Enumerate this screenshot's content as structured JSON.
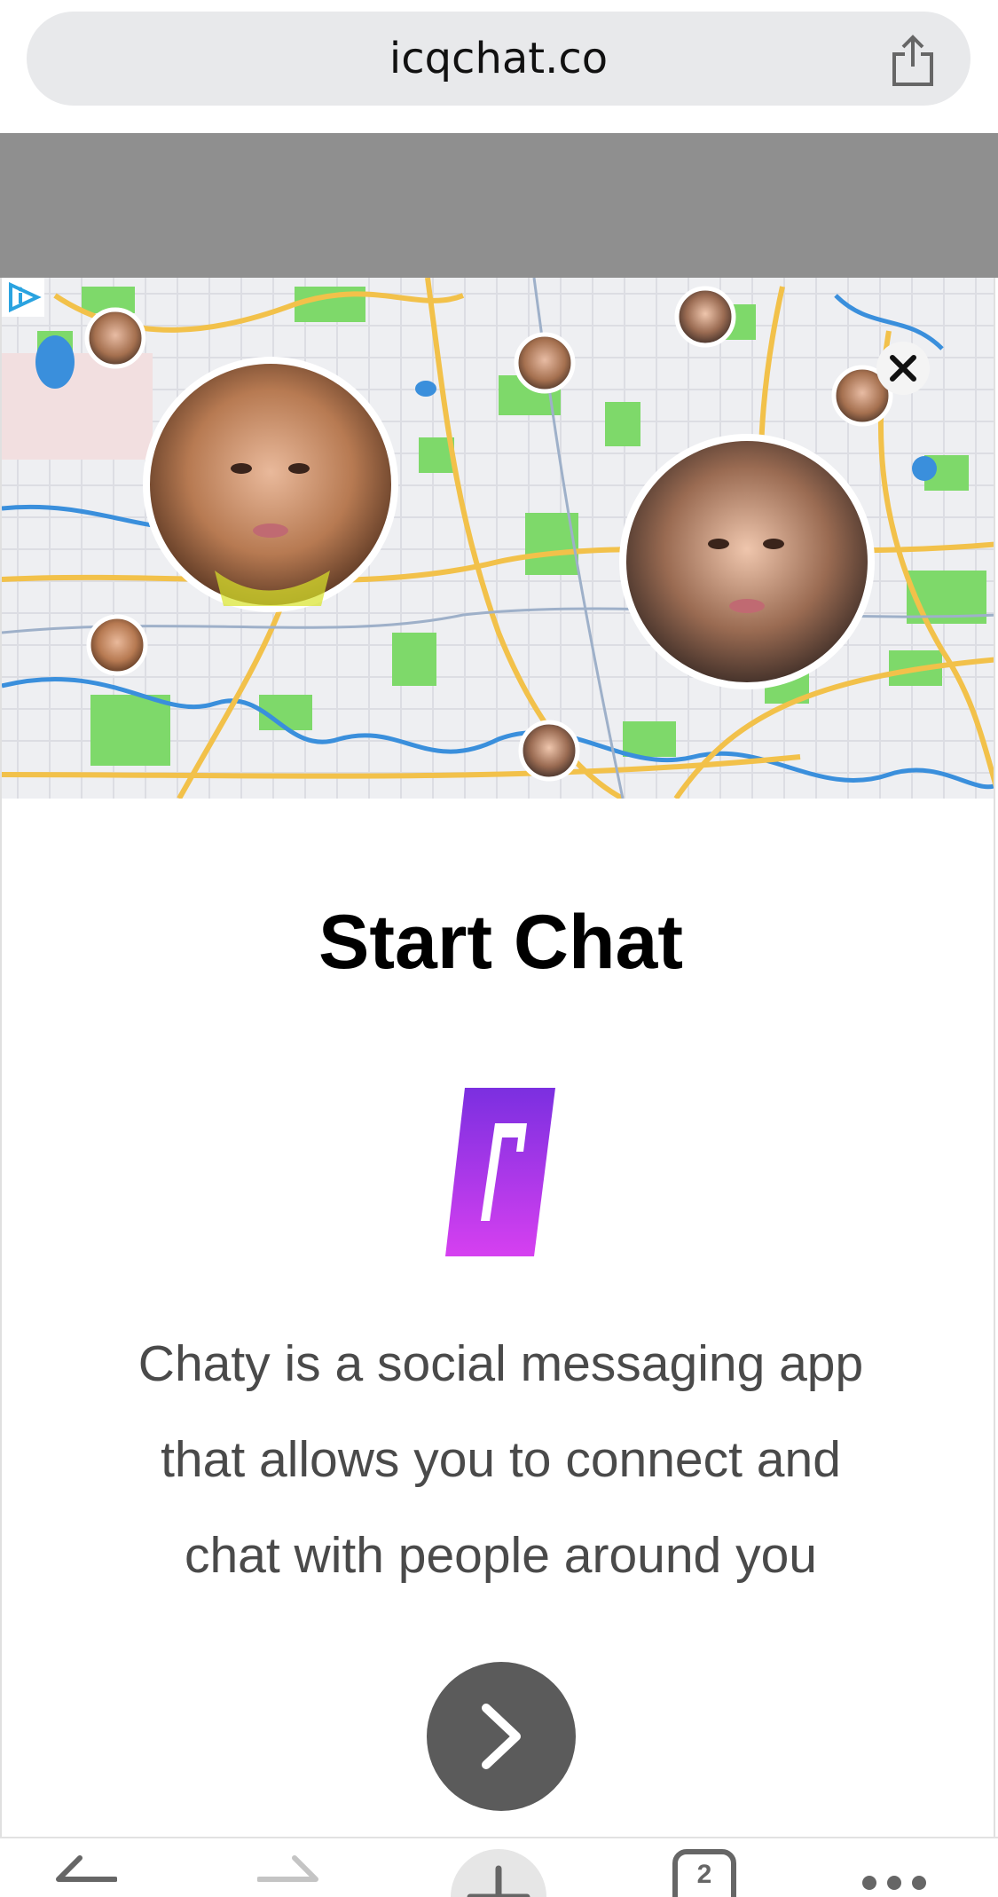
{
  "browser": {
    "url": "icqchat.co",
    "icons": [
      "share-icon",
      "back-arrow-icon",
      "forward-arrow-icon",
      "new-tab-plus-icon",
      "tabs-icon",
      "more-icon"
    ],
    "tab_count": "2"
  },
  "ad": {
    "icons": [
      "adchoices-icon",
      "close-icon",
      "next-chevron-icon"
    ],
    "title": "Start Chat",
    "description_lines": [
      "Chaty is a social messaging app",
      "that allows you to connect and",
      "chat with people around you"
    ],
    "colors": {
      "logo_gradient_top": "#7b2fe0",
      "logo_gradient_bottom": "#d640f0",
      "button": "#5b5b5b",
      "map_water": "#3a8fdc",
      "map_park": "#7ed96a",
      "map_road": "#f2c14a"
    }
  }
}
